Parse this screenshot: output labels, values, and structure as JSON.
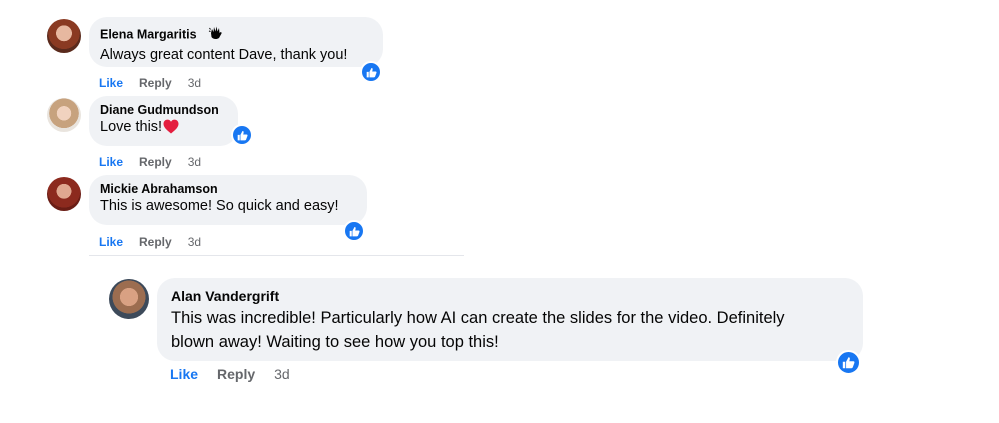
{
  "comments": [
    {
      "author": "Elena Margaritis",
      "text": "Always great content Dave, thank you!",
      "actions": {
        "like": "Like",
        "reply": "Reply",
        "time": "3d"
      },
      "reaction": "like"
    },
    {
      "author": "Diane Gudmundson",
      "text": "Love this!",
      "actions": {
        "like": "Like",
        "reply": "Reply",
        "time": "3d"
      },
      "reaction": "like"
    },
    {
      "author": "Mickie Abrahamson",
      "text": "This is awesome! So quick and easy!",
      "actions": {
        "like": "Like",
        "reply": "Reply",
        "time": "3d"
      },
      "reaction": "like"
    }
  ],
  "reply": {
    "author": "Alan Vandergrift",
    "text_line1": "This was incredible! Particularly how AI can create the slides for the video. Definitely",
    "text_line2": "blown away! Waiting to see how you top this!",
    "actions": {
      "like": "Like",
      "reply": "Reply",
      "time": "3d"
    },
    "reaction": "like"
  },
  "colors": {
    "bubble": "#f0f2f5",
    "like_blue": "#1877f2",
    "secondary_text": "#65676b",
    "heart": "#e41e3f"
  },
  "icons": {
    "author_badge": "waving-hand-icon",
    "reaction": "thumbs-up-icon",
    "emoji": "red-heart-icon"
  }
}
